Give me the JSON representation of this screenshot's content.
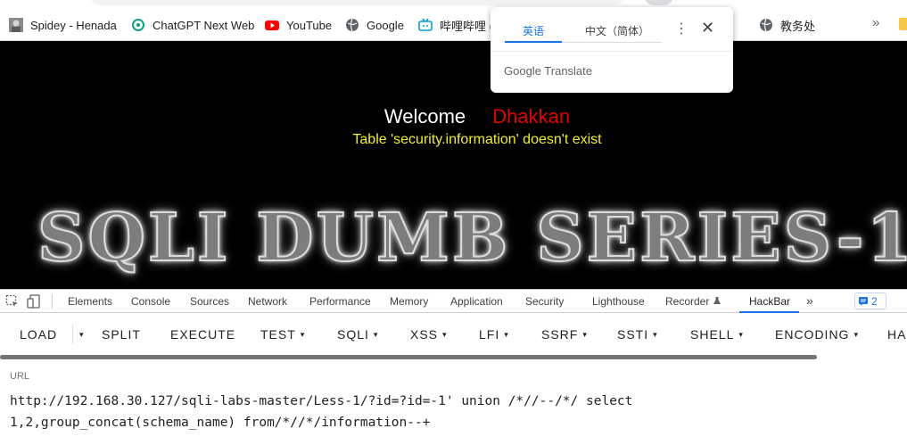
{
  "bookmarks": [
    {
      "label": "Spidey - Henada",
      "icon": "avatar-icon"
    },
    {
      "label": "ChatGPT Next Web",
      "icon": "openai-icon"
    },
    {
      "label": "YouTube",
      "icon": "youtube-icon"
    },
    {
      "label": "Google",
      "icon": "globe-icon"
    },
    {
      "label": "哔哩哔哩 (",
      "icon": "bilibili-icon"
    },
    {
      "label": "教务处",
      "icon": "globe-icon"
    }
  ],
  "bookmarks_more": "»",
  "page": {
    "welcome": "Welcome",
    "name": "Dhakkan",
    "error": "Table 'security.information' doesn't exist",
    "banner": "SQLI DUMB SERIES-1"
  },
  "translate_popup": {
    "tab_source": "英语",
    "tab_target": "中文（简体）",
    "menu": "⋮",
    "close": "✕",
    "brand": "Google Translate"
  },
  "devtools": {
    "tabs": [
      "Elements",
      "Console",
      "Sources",
      "Network",
      "Performance",
      "Memory",
      "Application",
      "Security",
      "Lighthouse",
      "Recorder",
      "HackBar"
    ],
    "active_tab": "HackBar",
    "more": "»",
    "issues_count": "2"
  },
  "hackbar": {
    "buttons": [
      "LOAD",
      "SPLIT",
      "EXECUTE",
      "TEST",
      "SQLI",
      "XSS",
      "LFI",
      "SSRF",
      "SSTI",
      "SHELL",
      "ENCODING",
      "HA"
    ],
    "caret": "▾",
    "url_label": "URL",
    "url_line1": "http://192.168.30.127/sqli-labs-master/Less-1/?id=?id=-1' union /*//--/*/ select",
    "url_line2": "1,2,group_concat(schema_name) from/*//*/information--+"
  },
  "colors": {
    "page_bg": "#000000",
    "welcome": "#ffffff",
    "name": "#e00000",
    "error": "#f2ef2e",
    "accent": "#1a73e8"
  }
}
